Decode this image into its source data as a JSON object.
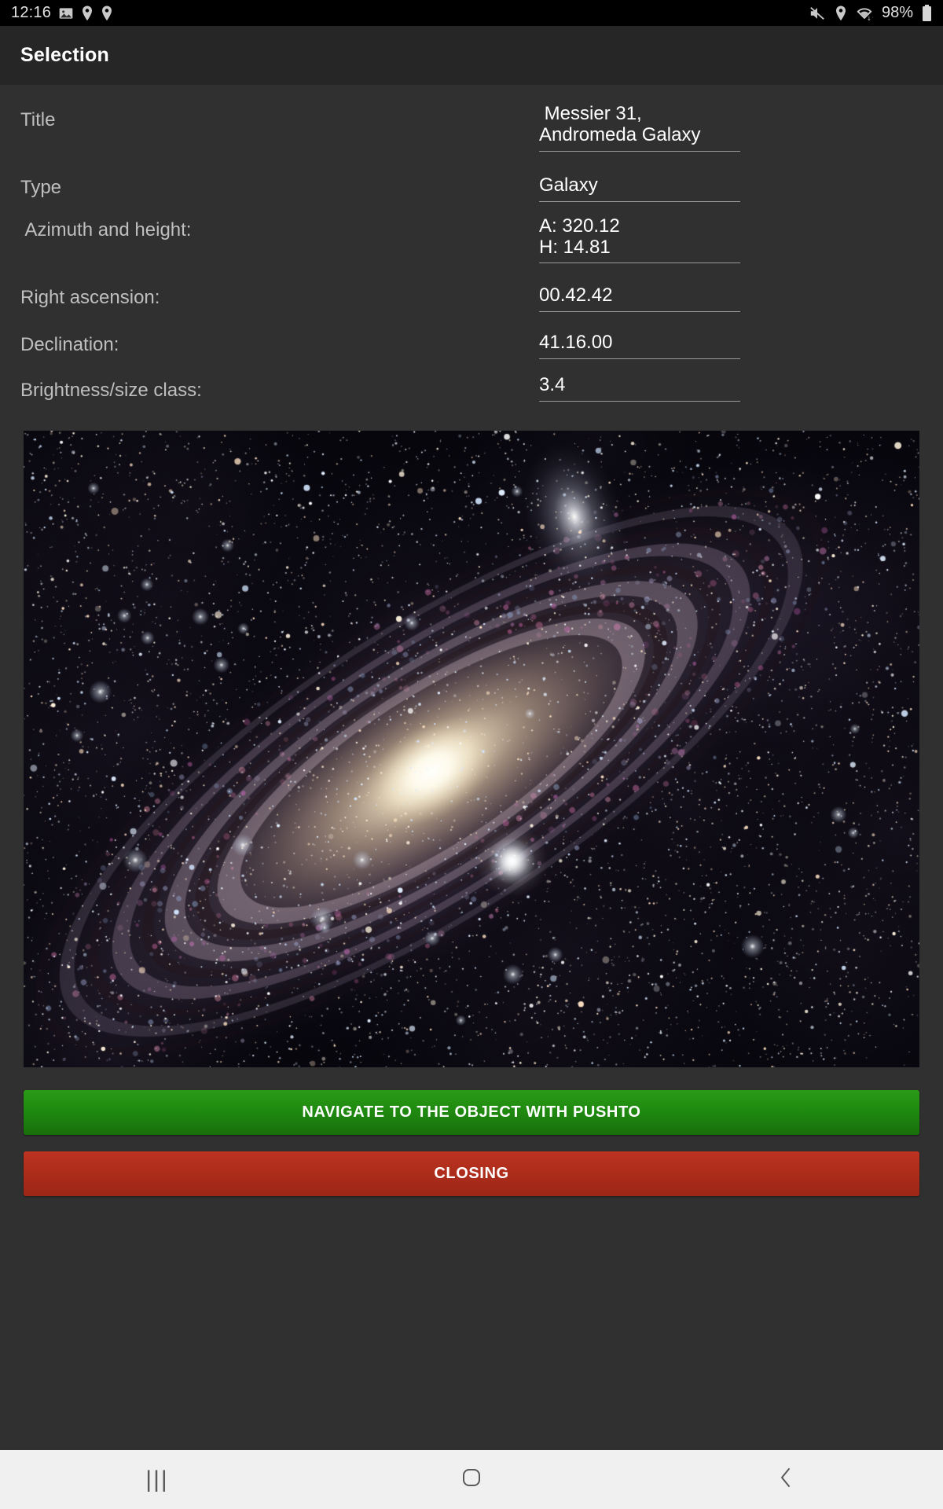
{
  "statusbar": {
    "time": "12:16",
    "battery_percent": "98%",
    "left_icons": [
      "image-icon",
      "location-pin-icon",
      "location-pin-icon"
    ],
    "right_icons": [
      "mute-icon",
      "location-pin-icon",
      "wifi-icon",
      "battery-icon"
    ]
  },
  "appbar": {
    "title": "Selection"
  },
  "details": {
    "rows": [
      {
        "label": "Title",
        "value": " Messier 31, Andromeda Galaxy"
      },
      {
        "label": "Type",
        "value": "Galaxy"
      },
      {
        "label": " Azimuth and height:",
        "value": "A: 320.12\nH: 14.81"
      },
      {
        "label": "Right ascension:",
        "value": "00.42.42"
      },
      {
        "label": "Declination:",
        "value": "41.16.00"
      },
      {
        "label": "Brightness/size class:",
        "value": "3.4"
      }
    ]
  },
  "image": {
    "name": "andromeda-galaxy-photo",
    "alt": "Messier 31 Andromeda Galaxy photograph"
  },
  "buttons": {
    "navigate": "NAVIGATE TO THE OBJECT WITH PUSHTO",
    "close": "CLOSING"
  },
  "navbar": {
    "recents": "|||",
    "home": "home-icon",
    "back": "back-icon"
  },
  "colors": {
    "background": "#303030",
    "appbar": "#262626",
    "statusbar": "#000000",
    "navigate_button": "#1f8a10",
    "close_button": "#ad2c1b",
    "label_text": "#bfbfbf",
    "value_text": "#ffffff",
    "navbar": "#f0f0f0"
  }
}
